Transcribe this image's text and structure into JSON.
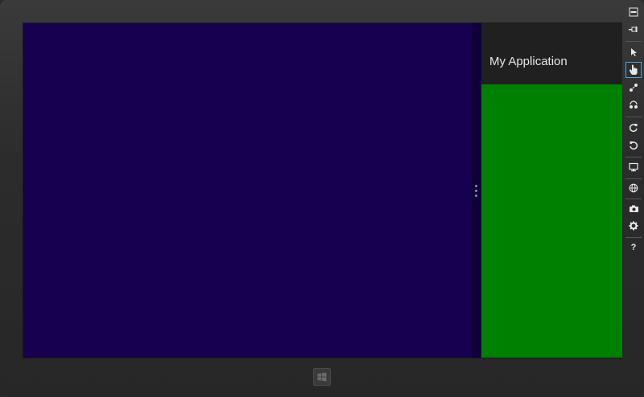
{
  "app": {
    "snapped_title": "My Application"
  },
  "colors": {
    "main_pane": "#170050",
    "snap_pane": "#008000",
    "snap_header": "#202020",
    "frame": "#2b2b2b",
    "active_tool_border": "#4aa3df"
  },
  "toolbar": {
    "tools": [
      {
        "name": "minimize-icon"
      },
      {
        "name": "pin-icon"
      },
      {
        "name": "mouse-mode-icon"
      },
      {
        "name": "touch-mode-icon",
        "active": true
      },
      {
        "name": "pinch-zoom-icon"
      },
      {
        "name": "rotate-touch-icon"
      },
      {
        "name": "rotate-clockwise-icon"
      },
      {
        "name": "rotate-counterclockwise-icon"
      },
      {
        "name": "resolution-icon"
      },
      {
        "name": "location-icon"
      },
      {
        "name": "screenshot-icon"
      },
      {
        "name": "settings-icon"
      },
      {
        "name": "help-icon",
        "label": "?"
      }
    ]
  },
  "hardware": {
    "windows_button": "windows-logo-icon"
  }
}
